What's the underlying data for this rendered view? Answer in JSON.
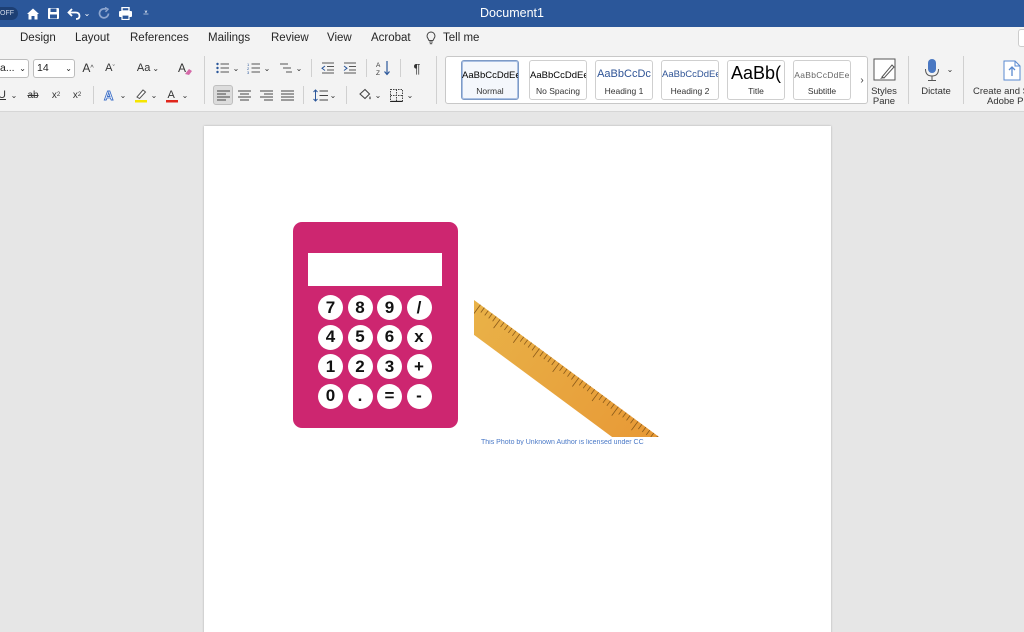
{
  "titlebar": {
    "autosave": "OFF",
    "document_title": "Document1",
    "icons": [
      "home-icon",
      "save-icon",
      "undo-icon",
      "redo-icon",
      "print-icon",
      "customize-icon"
    ]
  },
  "menu": {
    "tabs": [
      "Design",
      "Layout",
      "References",
      "Mailings",
      "Review",
      "View",
      "Acrobat"
    ],
    "tell_me": "Tell me"
  },
  "ribbon": {
    "font_name": "a...",
    "font_size": "14",
    "change_case": "Aa",
    "styles": [
      {
        "preview": "AaBbCcDdEe",
        "label": "Normal",
        "selected": true
      },
      {
        "preview": "AaBbCcDdEe",
        "label": "No Spacing",
        "selected": false
      },
      {
        "preview": "AaBbCcDc",
        "label": "Heading 1",
        "selected": false
      },
      {
        "preview": "AaBbCcDdEe",
        "label": "Heading 2",
        "selected": false
      },
      {
        "preview": "AaBb(",
        "label": "Title",
        "selected": false
      },
      {
        "preview": "AaBbCcDdEe",
        "label": "Subtitle",
        "selected": false
      }
    ],
    "styles_pane": [
      "Styles",
      "Pane"
    ],
    "dictate": "Dictate",
    "create_pdf": [
      "Create and S",
      "Adobe PI"
    ],
    "colors": {
      "highlight": "#f5e500",
      "font_color": "#e0261c",
      "accent": "#2b579a"
    }
  },
  "document": {
    "calculator_keys": [
      "7",
      "8",
      "9",
      "/",
      "4",
      "5",
      "6",
      "x",
      "1",
      "2",
      "3",
      "+",
      "0",
      ".",
      "=",
      "-"
    ],
    "calculator_color": "#cd2670",
    "ruler_color": "#e9a33a",
    "caption": "This Photo by Unknown Author is licensed under CC"
  }
}
